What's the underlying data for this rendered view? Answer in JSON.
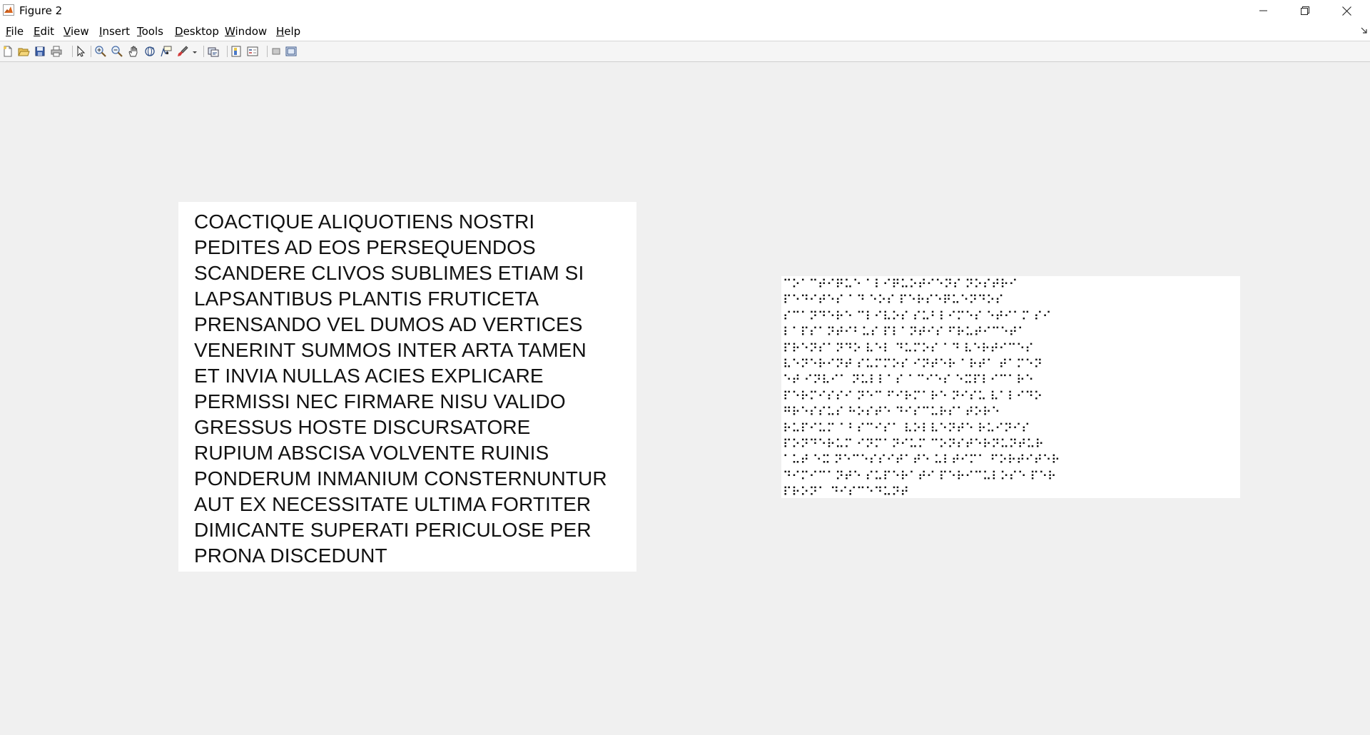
{
  "window": {
    "title": "Figure 2"
  },
  "menu": {
    "items": [
      {
        "mnemonic": "F",
        "rest": "ile"
      },
      {
        "mnemonic": "E",
        "rest": "dit"
      },
      {
        "mnemonic": "V",
        "rest": "iew"
      },
      {
        "mnemonic": "I",
        "rest": "nsert"
      },
      {
        "mnemonic": "T",
        "rest": "ools"
      },
      {
        "mnemonic": "D",
        "rest": "esktop"
      },
      {
        "mnemonic": "W",
        "rest": "indow"
      },
      {
        "mnemonic": "H",
        "rest": "elp"
      }
    ]
  },
  "toolbar": {
    "buttons": [
      "new-figure-icon",
      "open-file-icon",
      "save-figure-icon",
      "print-figure-icon",
      "edit-plot-arrow-icon",
      "zoom-in-icon",
      "zoom-out-icon",
      "pan-hand-icon",
      "rotate-3d-icon",
      "data-cursor-icon",
      "brush-icon",
      "brush-dropdown-icon",
      "link-plot-icon",
      "insert-colorbar-icon",
      "insert-legend-icon",
      "hide-plot-tools-icon",
      "show-plot-tools-icon"
    ]
  },
  "text_panel": {
    "lines": [
      "COACTIQUE ALIQUOTIENS NOSTRI",
      "PEDITES AD EOS PERSEQUENDOS",
      "SCANDERE CLIVOS SUBLIMES ETIAM SI",
      "LAPSANTIBUS PLANTIS FRUTICETA",
      "PRENSANDO VEL DUMOS AD VERTICES",
      "VENERINT SUMMOS INTER ARTA TAMEN",
      "ET INVIA NULLAS ACIES EXPLICARE",
      "PERMISSI NEC FIRMARE NISU VALIDO",
      "GRESSUS HOSTE DISCURSATORE",
      "RUPIUM ABSCISA VOLVENTE RUINIS",
      "PONDERUM INMANIUM CONSTERNUNTUR",
      "AUT EX NECESSITATE ULTIMA FORTITER",
      "DIMICANTE SUPERATI PERICULOSE PER",
      "PRONA DISCEDUNT"
    ]
  },
  "braille_panel": {
    "lines": [
      "⠉⠕⠁⠉⠞⠊⠟⠥⠑ ⠁⠇⠊⠟⠥⠕⠞⠊⠑⠝⠎ ⠝⠕⠎⠞⠗⠊",
      "⠏⠑⠙⠊⠞⠑⠎ ⠁⠙ ⠑⠕⠎ ⠏⠑⠗⠎⠑⠟⠥⠑⠝⠙⠕⠎",
      "⠎⠉⠁⠝⠙⠑⠗⠑ ⠉⠇⠊⠧⠕⠎ ⠎⠥⠃⠇⠊⠍⠑⠎ ⠑⠞⠊⠁⠍ ⠎⠊",
      "⠇⠁⠏⠎⠁⠝⠞⠊⠃⠥⠎ ⠏⠇⠁⠝⠞⠊⠎ ⠋⠗⠥⠞⠊⠉⠑⠞⠁",
      "⠏⠗⠑⠝⠎⠁⠝⠙⠕ ⠧⠑⠇ ⠙⠥⠍⠕⠎ ⠁⠙ ⠧⠑⠗⠞⠊⠉⠑⠎",
      "⠧⠑⠝⠑⠗⠊⠝⠞ ⠎⠥⠍⠍⠕⠎ ⠊⠝⠞⠑⠗ ⠁⠗⠞⠁ ⠞⠁⠍⠑⠝",
      "⠑⠞ ⠊⠝⠧⠊⠁ ⠝⠥⠇⠇⠁⠎ ⠁⠉⠊⠑⠎ ⠑⠭⠏⠇⠊⠉⠁⠗⠑",
      "⠏⠑⠗⠍⠊⠎⠎⠊ ⠝⠑⠉ ⠋⠊⠗⠍⠁⠗⠑ ⠝⠊⠎⠥ ⠧⠁⠇⠊⠙⠕",
      "⠛⠗⠑⠎⠎⠥⠎ ⠓⠕⠎⠞⠑ ⠙⠊⠎⠉⠥⠗⠎⠁⠞⠕⠗⠑",
      "⠗⠥⠏⠊⠥⠍ ⠁⠃⠎⠉⠊⠎⠁ ⠧⠕⠇⠧⠑⠝⠞⠑ ⠗⠥⠊⠝⠊⠎",
      "⠏⠕⠝⠙⠑⠗⠥⠍ ⠊⠝⠍⠁⠝⠊⠥⠍ ⠉⠕⠝⠎⠞⠑⠗⠝⠥⠝⠞⠥⠗",
      "⠁⠥⠞ ⠑⠭ ⠝⠑⠉⠑⠎⠎⠊⠞⠁⠞⠑ ⠥⠇⠞⠊⠍⠁ ⠋⠕⠗⠞⠊⠞⠑⠗",
      "⠙⠊⠍⠊⠉⠁⠝⠞⠑ ⠎⠥⠏⠑⠗⠁⠞⠊ ⠏⠑⠗⠊⠉⠥⠇⠕⠎⠑ ⠏⠑⠗",
      "⠏⠗⠕⠝⠁ ⠙⠊⠎⠉⠑⠙⠥⠝⠞"
    ]
  }
}
